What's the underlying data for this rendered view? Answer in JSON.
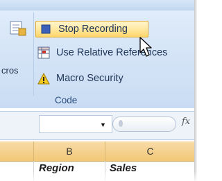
{
  "ribbon": {
    "macros_label": "cros",
    "items": [
      {
        "label": "Stop Recording",
        "icon": "stop-square-icon"
      },
      {
        "label": "Use Relative References",
        "icon": "relative-references-icon"
      },
      {
        "label": "Macro Security",
        "icon": "warning-icon"
      }
    ],
    "group_label": "Code"
  },
  "formula_bar": {
    "fx_label": "fx"
  },
  "sheet": {
    "columns": [
      "B",
      "C"
    ],
    "row": [
      "Region",
      "Sales"
    ]
  },
  "colors": {
    "ribbon_bg": "#d6e5f7",
    "highlight": "#ffe8a0",
    "header_bg": "#f2c877"
  }
}
